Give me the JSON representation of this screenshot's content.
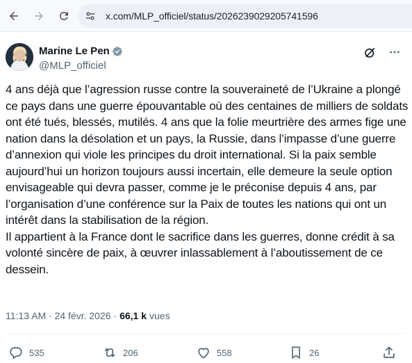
{
  "browser": {
    "url": "x.com/MLP_officiel/status/2026239029205741596"
  },
  "author": {
    "name": "Marine Le Pen",
    "handle": "@MLP_officiel",
    "verified_color": "#829aab"
  },
  "tweet": {
    "text": "4 ans déjà que l’agression russe contre la souveraineté de l’Ukraine a plongé ce pays dans une guerre épouvantable où des centaines de milliers de soldats ont été tués, blessés, mutilés. 4 ans que la folie meurtrière des armes fige une nation dans la désolation et un pays, la Russie, dans l’impasse d’une guerre d’annexion qui viole les principes du droit international. Si la paix semble aujourd’hui un horizon toujours aussi incertain, elle demeure la seule option envisageable qui devra passer, comme je le préconise depuis 4 ans, par l’organisation d’une conférence sur la Paix de toutes les nations qui ont un intérêt dans la stabilisation de la région.\nIl appartient à la France dont le sacrifice dans les guerres, donne crédit à sa volonté sincère de paix, à œuvrer inlassablement à l’aboutissement de ce dessein.",
    "time": "11:13 AM · 24 févr. 2026 ·",
    "views_count": "66,1 k",
    "views_label": "vues"
  },
  "actions": {
    "replies": "535",
    "reposts": "206",
    "likes": "558",
    "bookmarks": "26"
  },
  "icons": {
    "back": "arrow-left-icon",
    "forward": "arrow-right-icon",
    "reload": "reload-icon",
    "site_info": "tune-icon",
    "grok": "grok-icon",
    "more": "more-horizontal-icon",
    "reply": "reply-icon",
    "repost": "repost-icon",
    "like": "heart-icon",
    "bookmark": "bookmark-icon",
    "share": "share-icon"
  }
}
